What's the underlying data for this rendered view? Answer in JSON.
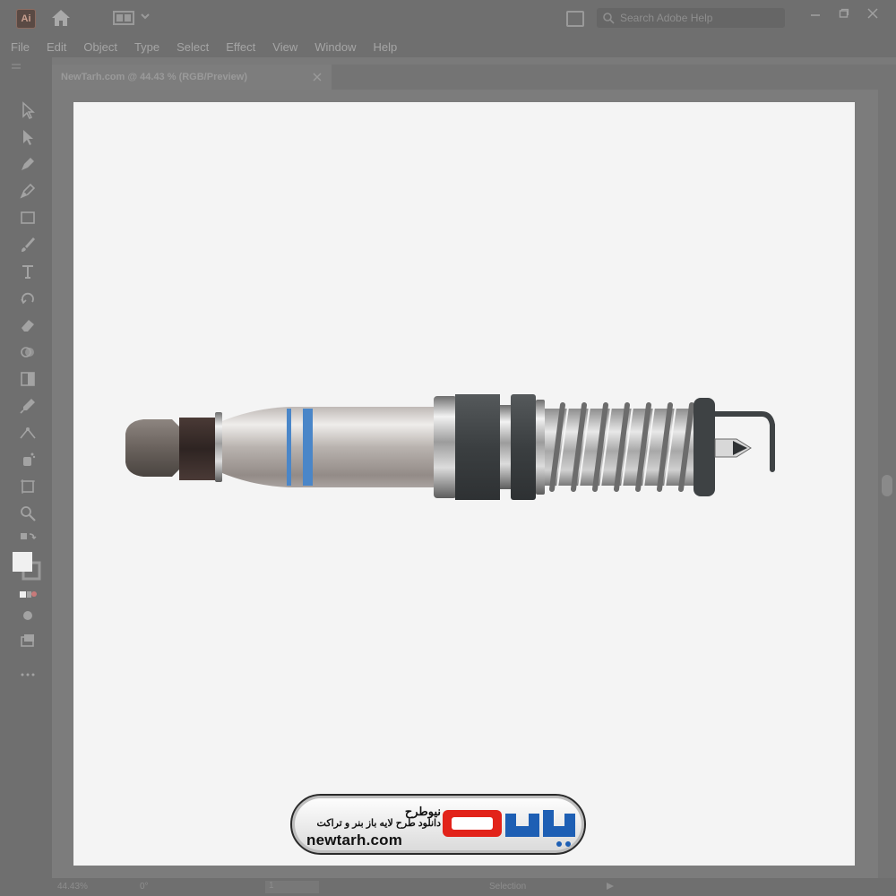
{
  "app": {
    "logo_text": "Ai",
    "search_placeholder": "Search Adobe Help"
  },
  "menu": [
    "File",
    "Edit",
    "Object",
    "Type",
    "Select",
    "Effect",
    "View",
    "Window",
    "Help"
  ],
  "document_tab": {
    "title": "NewTarh.com @ 44.43 % (RGB/Preview)"
  },
  "statusbar": {
    "zoom": "44.43%",
    "rotation": "0°",
    "artboard": "1",
    "mode": "Selection"
  },
  "watermark": {
    "name": "نیوطرح",
    "tagline": "دانلود طرح لایه باز بنر و تراکت",
    "url": "newtarh.com",
    "logo_text": "نیوطرح"
  },
  "colors": {
    "chrome": "#6f6f6f",
    "artboard": "#f4f4f4",
    "logo_red": "#e2231a",
    "logo_blue": "#1e5fb4",
    "stripe_blue": "#4a86c8"
  }
}
